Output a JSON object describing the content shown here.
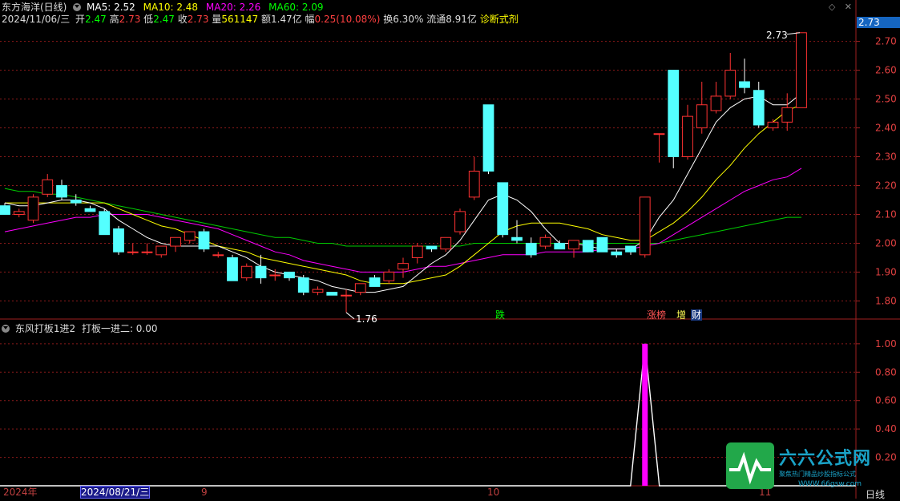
{
  "header": {
    "stock_name": "东方海洋(日线)",
    "ma_items": [
      {
        "label": "MA5: 2.52",
        "color": "#ffffff"
      },
      {
        "label": "MA10: 2.48",
        "color": "#ffff00"
      },
      {
        "label": "MA20: 2.26",
        "color": "#ff00ff"
      },
      {
        "label": "MA60: 2.09",
        "color": "#00ff00"
      }
    ],
    "date": "2024/11/06/三",
    "open_label": "开",
    "open": "2.47",
    "high_label": "高",
    "high": "2.73",
    "low_label": "低",
    "low": "2.47",
    "close_label": "收",
    "close": "2.73",
    "volume_label": "量",
    "volume": "561147",
    "amount_label": "额",
    "amount": "1.47亿",
    "change_label": "幅",
    "change": "0.25(10.08%)",
    "turnover_label": "换",
    "turnover": "6.30%",
    "float_label": "流通",
    "float": "8.91亿",
    "diagnose": "诊断式剂"
  },
  "sub_header": {
    "indicator_name": "东风打板1进2",
    "value_label": "打板一进二: 0.00"
  },
  "right_panel": {
    "price_badge": "2.73",
    "period": "日线"
  },
  "price_axis": {
    "ticks": [
      "2.70",
      "2.60",
      "2.50",
      "2.40",
      "2.30",
      "2.20",
      "2.10",
      "2.00",
      "1.90",
      "1.80"
    ],
    "tick_values": [
      2.7,
      2.6,
      2.5,
      2.4,
      2.3,
      2.2,
      2.1,
      2.0,
      1.9,
      1.8
    ]
  },
  "sub_axis": {
    "ticks": [
      "1.00",
      "0.80",
      "0.60",
      "0.40",
      "0.20"
    ],
    "tick_values": [
      1.0,
      0.8,
      0.6,
      0.4,
      0.2
    ]
  },
  "time_axis": [
    {
      "label": "2024年",
      "selected": false
    },
    {
      "label": "2024/08/21/三",
      "selected": true
    },
    {
      "label": "9",
      "selected": false
    },
    {
      "label": "10",
      "selected": false
    },
    {
      "label": "11",
      "selected": false
    }
  ],
  "annotations": {
    "high_marker": "2.73",
    "low_marker": "1.76"
  },
  "events": [
    {
      "label": "跌",
      "color": "#00ff00",
      "bg": "#002200"
    },
    {
      "label": "涨榜",
      "color": "#ff5555",
      "bg": "#220000"
    },
    {
      "label": "增",
      "color": "#ffff55",
      "bg": "#222200"
    },
    {
      "label": "财",
      "color": "#ffffff",
      "bg": "#112255"
    }
  ],
  "watermark": {
    "title": "六六公式网",
    "subtitle": "聚焦热门精品炒股指标公式",
    "url": "WWW.66gsw.com"
  },
  "colors": {
    "up": "#ff3232",
    "down": "#54ffff",
    "ma5": "#ffffff",
    "ma10": "#ffff00",
    "ma20": "#ff00ff",
    "ma60": "#00cc00",
    "grid": "#8b1a1a",
    "signal": "#ff00ff"
  },
  "chart_data": {
    "type": "candlestick",
    "candles": [
      [
        2.13,
        2.14,
        2.1,
        2.1
      ],
      [
        2.1,
        2.12,
        2.09,
        2.11
      ],
      [
        2.08,
        2.17,
        2.07,
        2.16
      ],
      [
        2.17,
        2.24,
        2.16,
        2.22
      ],
      [
        2.2,
        2.22,
        2.15,
        2.16
      ],
      [
        2.15,
        2.17,
        2.13,
        2.14
      ],
      [
        2.12,
        2.13,
        2.11,
        2.11
      ],
      [
        2.11,
        2.12,
        2.03,
        2.03
      ],
      [
        2.05,
        2.06,
        1.96,
        1.97
      ],
      [
        1.97,
        2.0,
        1.96,
        1.97
      ],
      [
        1.97,
        2.0,
        1.96,
        1.97
      ],
      [
        1.96,
        1.99,
        1.95,
        1.99
      ],
      [
        1.99,
        2.02,
        1.97,
        2.02
      ],
      [
        2.01,
        2.04,
        2.0,
        2.04
      ],
      [
        2.04,
        2.05,
        1.97,
        1.98
      ],
      [
        1.96,
        1.97,
        1.95,
        1.96
      ],
      [
        1.95,
        1.96,
        1.87,
        1.87
      ],
      [
        1.88,
        1.93,
        1.87,
        1.92
      ],
      [
        1.92,
        1.96,
        1.86,
        1.88
      ],
      [
        1.89,
        1.91,
        1.87,
        1.89
      ],
      [
        1.9,
        1.9,
        1.87,
        1.88
      ],
      [
        1.88,
        1.89,
        1.82,
        1.83
      ],
      [
        1.83,
        1.85,
        1.82,
        1.84
      ],
      [
        1.83,
        1.83,
        1.82,
        1.82
      ],
      [
        1.82,
        1.84,
        1.76,
        1.82
      ],
      [
        1.83,
        1.86,
        1.82,
        1.86
      ],
      [
        1.88,
        1.89,
        1.85,
        1.85
      ],
      [
        1.87,
        1.91,
        1.86,
        1.9
      ],
      [
        1.91,
        1.95,
        1.88,
        1.93
      ],
      [
        1.95,
        2.0,
        1.93,
        1.99
      ],
      [
        1.99,
        1.99,
        1.97,
        1.98
      ],
      [
        1.98,
        2.02,
        1.97,
        2.02
      ],
      [
        2.04,
        2.12,
        2.03,
        2.11
      ],
      [
        2.16,
        2.3,
        2.15,
        2.25
      ],
      [
        2.48,
        2.48,
        2.24,
        2.25
      ],
      [
        2.21,
        2.21,
        2.02,
        2.03
      ],
      [
        2.02,
        2.08,
        2.0,
        2.01
      ],
      [
        2.0,
        2.02,
        1.95,
        1.96
      ],
      [
        1.99,
        2.03,
        1.98,
        2.02
      ],
      [
        2.0,
        2.01,
        1.98,
        1.98
      ],
      [
        1.98,
        2.0,
        1.95,
        2.01
      ],
      [
        2.01,
        2.01,
        1.97,
        1.97
      ],
      [
        2.02,
        2.02,
        1.97,
        1.97
      ],
      [
        1.97,
        1.98,
        1.95,
        1.96
      ],
      [
        1.99,
        1.99,
        1.96,
        1.97
      ],
      [
        1.96,
        2.16,
        1.95,
        2.16
      ],
      [
        2.38,
        2.38,
        2.28,
        2.38
      ],
      [
        2.6,
        2.6,
        2.26,
        2.3
      ],
      [
        2.3,
        2.48,
        2.29,
        2.44
      ],
      [
        2.4,
        2.56,
        2.38,
        2.48
      ],
      [
        2.46,
        2.56,
        2.45,
        2.51
      ],
      [
        2.51,
        2.66,
        2.5,
        2.6
      ],
      [
        2.56,
        2.64,
        2.52,
        2.54
      ],
      [
        2.53,
        2.56,
        2.4,
        2.41
      ],
      [
        2.4,
        2.43,
        2.39,
        2.42
      ],
      [
        2.42,
        2.52,
        2.39,
        2.47
      ],
      [
        2.47,
        2.73,
        2.47,
        2.73
      ]
    ],
    "ma5": [
      2.14,
      2.13,
      2.13,
      2.14,
      2.15,
      2.15,
      2.14,
      2.12,
      2.08,
      2.05,
      2.02,
      2.0,
      1.99,
      1.99,
      1.99,
      1.99,
      1.97,
      1.95,
      1.92,
      1.9,
      1.89,
      1.88,
      1.87,
      1.85,
      1.84,
      1.83,
      1.83,
      1.84,
      1.85,
      1.89,
      1.93,
      1.96,
      2.01,
      2.08,
      2.15,
      2.17,
      2.15,
      2.11,
      2.05,
      2.0,
      2.0,
      1.99,
      1.98,
      1.98,
      1.98,
      2.01,
      2.09,
      2.15,
      2.24,
      2.33,
      2.42,
      2.47,
      2.5,
      2.51,
      2.48,
      2.48,
      2.52
    ],
    "ma10": [
      2.14,
      2.14,
      2.14,
      2.14,
      2.14,
      2.14,
      2.14,
      2.14,
      2.12,
      2.1,
      2.08,
      2.06,
      2.05,
      2.03,
      2.01,
      1.99,
      1.98,
      1.97,
      1.95,
      1.94,
      1.93,
      1.92,
      1.91,
      1.9,
      1.89,
      1.87,
      1.86,
      1.86,
      1.86,
      1.87,
      1.88,
      1.89,
      1.92,
      1.96,
      2.0,
      2.04,
      2.06,
      2.07,
      2.07,
      2.07,
      2.06,
      2.05,
      2.03,
      2.02,
      2.01,
      2.01,
      2.04,
      2.07,
      2.11,
      2.16,
      2.22,
      2.27,
      2.33,
      2.38,
      2.42,
      2.46,
      2.48
    ],
    "ma20": [
      2.04,
      2.05,
      2.06,
      2.07,
      2.08,
      2.09,
      2.09,
      2.1,
      2.1,
      2.1,
      2.1,
      2.09,
      2.08,
      2.07,
      2.06,
      2.05,
      2.03,
      2.01,
      1.99,
      1.97,
      1.96,
      1.94,
      1.93,
      1.92,
      1.91,
      1.9,
      1.9,
      1.9,
      1.9,
      1.91,
      1.92,
      1.92,
      1.93,
      1.94,
      1.95,
      1.96,
      1.96,
      1.96,
      1.97,
      1.97,
      1.97,
      1.97,
      1.98,
      1.98,
      1.98,
      1.99,
      2.0,
      2.03,
      2.06,
      2.09,
      2.12,
      2.15,
      2.18,
      2.2,
      2.22,
      2.23,
      2.26
    ],
    "ma60": [
      2.19,
      2.18,
      2.18,
      2.17,
      2.17,
      2.16,
      2.15,
      2.14,
      2.13,
      2.12,
      2.11,
      2.1,
      2.09,
      2.08,
      2.07,
      2.06,
      2.05,
      2.04,
      2.03,
      2.02,
      2.02,
      2.01,
      2.0,
      2.0,
      1.99,
      1.99,
      1.99,
      1.99,
      1.99,
      1.99,
      1.99,
      1.99,
      1.99,
      2.0,
      2.0,
      2.0,
      2.0,
      2.0,
      2.0,
      2.0,
      2.0,
      2.0,
      2.0,
      2.0,
      2.0,
      2.0,
      2.0,
      2.01,
      2.02,
      2.03,
      2.04,
      2.05,
      2.06,
      2.07,
      2.08,
      2.09,
      2.09
    ],
    "signal": {
      "index": 45,
      "value": 1.0
    },
    "ylim_main": [
      1.74,
      2.76
    ],
    "ylim_sub": [
      0,
      1.05
    ]
  }
}
